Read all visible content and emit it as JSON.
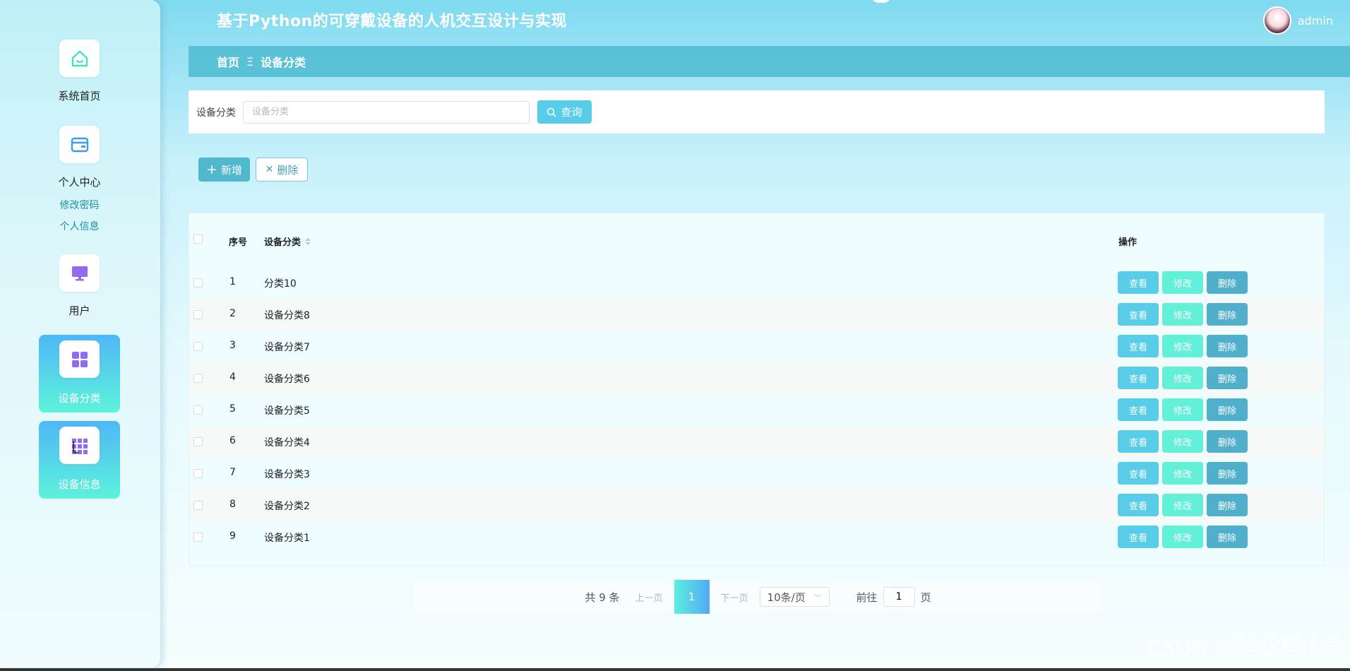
{
  "app": {
    "title": "基于Python的可穿戴设备的人机交互设计与实现"
  },
  "user": {
    "name": "admin"
  },
  "sidebar": {
    "items": [
      {
        "label": "系统首页",
        "icon": "home-icon"
      },
      {
        "label": "个人中心",
        "icon": "wallet-icon",
        "sub": [
          "修改密码",
          "个人信息"
        ]
      },
      {
        "label": "用户",
        "icon": "monitor-icon"
      },
      {
        "label": "设备分类",
        "icon": "grid-icon",
        "active": true
      },
      {
        "label": "设备信息",
        "icon": "table-grid-icon",
        "active": true
      }
    ]
  },
  "breadcrumb": {
    "home": "首页",
    "separator": "Ξ",
    "current": "设备分类"
  },
  "search": {
    "label": "设备分类",
    "placeholder": "设备分类",
    "value": "",
    "button": "查询"
  },
  "actions": {
    "add": "新增",
    "delete": "删除"
  },
  "table": {
    "headers": {
      "index": "序号",
      "category": "设备分类",
      "ops": "操作"
    },
    "op_labels": {
      "view": "查看",
      "edit": "修改",
      "delete": "删除"
    },
    "rows": [
      {
        "index": "1",
        "name": "分类10"
      },
      {
        "index": "2",
        "name": "设备分类8"
      },
      {
        "index": "3",
        "name": "设备分类7"
      },
      {
        "index": "4",
        "name": "设备分类6"
      },
      {
        "index": "5",
        "name": "设备分类5"
      },
      {
        "index": "6",
        "name": "设备分类4"
      },
      {
        "index": "7",
        "name": "设备分类3"
      },
      {
        "index": "8",
        "name": "设备分类2"
      },
      {
        "index": "9",
        "name": "设备分类1"
      }
    ]
  },
  "pagination": {
    "total": "共 9 条",
    "prev": "上一页",
    "current": "1",
    "next": "下一页",
    "page_size": "10条/页",
    "goto_prefix": "前往",
    "goto_value": "1",
    "goto_suffix": "页"
  },
  "watermark": "CSDN @毕业程序员",
  "colors": {
    "accent": "#57cdea",
    "edit": "#63f0d8",
    "delete": "#50b0cb",
    "breadcrumb_bg": "#5ac1d6"
  }
}
